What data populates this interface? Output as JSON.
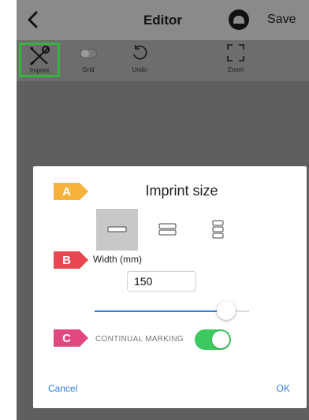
{
  "navbar": {
    "title": "Editor",
    "save_label": "Save"
  },
  "toolbar": {
    "items": [
      {
        "label": "Imprint",
        "icon": "wrench-screwdriver-icon",
        "active": true
      },
      {
        "label": "Grid",
        "icon": "toggle-icon"
      },
      {
        "label": "Undo",
        "icon": "undo-icon"
      },
      {
        "label": "Zoom",
        "icon": "zoom-frame-icon"
      }
    ],
    "active_color": "#35b43f"
  },
  "dialog": {
    "title": "Imprint size",
    "tags": {
      "a": "A",
      "b": "B",
      "c": "C"
    },
    "tag_colors": {
      "a": "#f7b23b",
      "b": "#e8474f",
      "c": "#e2487f"
    },
    "layout_options": [
      "single-line-icon",
      "double-line-icon",
      "triple-line-icon"
    ],
    "selected_layout": 0,
    "width_label": "Width (mm)",
    "width_value": "150",
    "slider_fraction": 0.85,
    "continual_marking_label": "CONTINUAL MARKING",
    "continual_marking_on": true,
    "cancel_label": "Cancel",
    "ok_label": "OK",
    "accent_color": "#2f7de1",
    "toggle_color": "#3ec95f"
  }
}
